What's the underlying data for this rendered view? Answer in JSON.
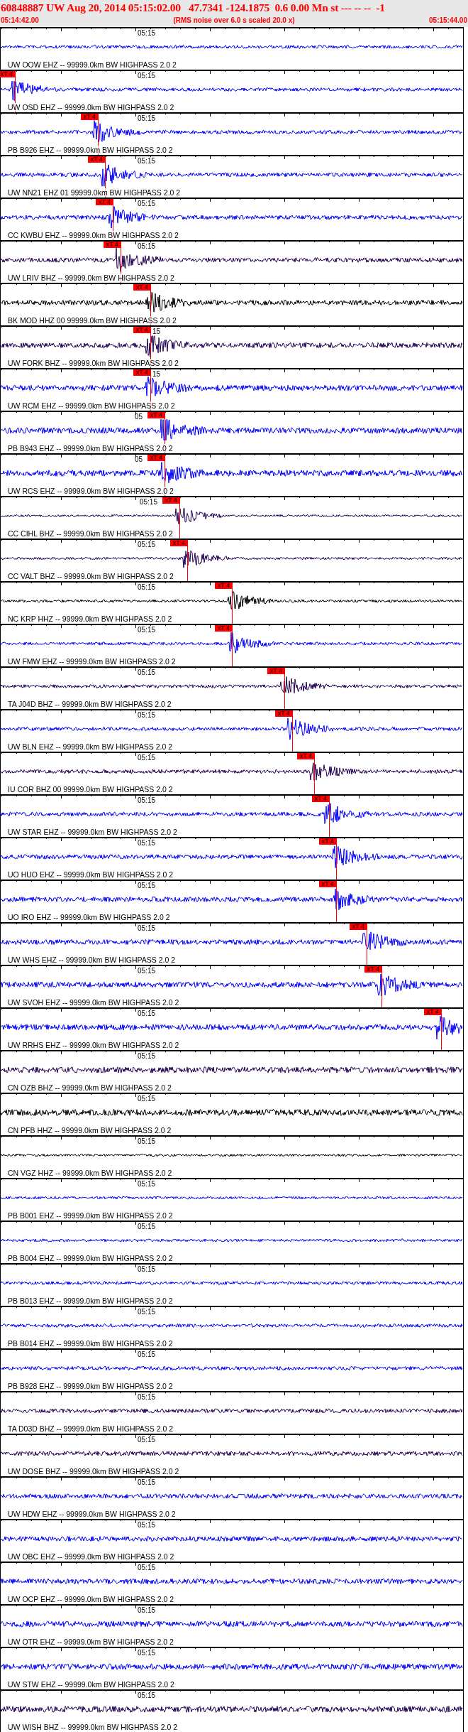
{
  "header": {
    "title": "60848887 UW Aug 20, 2014 05:15:02.00   47.7341 -124.1875  0.6 0.00 Mn st --- -- --  -1",
    "start_time": "05:14:42.00",
    "note": "(RMS noise over 6.0 s scaled 20.0 x)",
    "end_time": "05:15:44.00"
  },
  "traces": [
    {
      "time_mark": "05:15",
      "label": "UW OOW EHZ -- 99999.0km BW HIGHPASS 2.0 2",
      "color": "#0000ff"
    },
    {
      "time_mark": "05:15",
      "label": "UW OSD EHZ -- 99999.0km BW HIGHPASS 2.0 2",
      "color": "#0000ff",
      "pick": {
        "label": "xT 4",
        "level": 0.031
      }
    },
    {
      "time_mark": "05:15",
      "label": "PB B926 EHZ -- 99999.0km BW HIGHPASS 2.0 2",
      "color": "#0000ff",
      "pick": {
        "label": "xT 4",
        "level": 0.21
      }
    },
    {
      "time_mark": "05:15",
      "label": "UW NN21 EHZ 01 99999.0km BW HIGHPASS 2.0 2",
      "color": "#0000ff",
      "pick": {
        "label": "xT 4",
        "level": 0.226
      }
    },
    {
      "time_mark": "05:15",
      "label": "CC KWBU EHZ -- 99999.0km BW HIGHPASS 2.0 2",
      "color": "#0000ff",
      "pick": {
        "label": "xT 4",
        "level": 0.243
      }
    },
    {
      "time_mark": "05:15",
      "label": "UW LRIV BHZ -- 99999.0km BW HIGHPASS 2.0 2",
      "color": "#200050",
      "pick": {
        "label": "xT 4",
        "level": 0.259
      }
    },
    {
      "label": "BK MOD HHZ 00 99999.0km BW HIGHPASS 2.0 2",
      "color": "#000000",
      "pick": {
        "label": "xT 4",
        "level": 0.323
      }
    },
    {
      "time_mark": "15",
      "label": "UW FORK BHZ -- 99999.0km BW HIGHPASS 2.0 2",
      "color": "#200050",
      "pick": {
        "label": "xT 4",
        "level": 0.323
      }
    },
    {
      "time_mark": "15",
      "label": "UW RCM EHZ -- 99999.0km BW HIGHPASS 2.0 2",
      "color": "#0000ff",
      "pick": {
        "label": "xT 4",
        "level": 0.323
      }
    },
    {
      "time_mark": "05",
      "label": "PB B943 EHZ -- 99999.0km BW HIGHPASS 2.0 2",
      "color": "#0000ff",
      "pick": {
        "label": "xT 4",
        "level": 0.355
      }
    },
    {
      "time_mark": "05",
      "label": "UW RCS EHZ -- 99999.0km BW HIGHPASS 2.0 2",
      "color": "#0000ff",
      "pick": {
        "label": "xT 4",
        "level": 0.355
      }
    },
    {
      "time_mark": "05:15",
      "label": "CC CIHL BHZ -- 99999.0km BW HIGHPASS 2.0 2",
      "color": "#200050",
      "pick": {
        "label": "xT 4",
        "level": 0.387
      }
    },
    {
      "time_mark": "05:15",
      "label": "CC VALT BHZ -- 99999.0km BW HIGHPASS 2.0 2",
      "color": "#200050",
      "pick": {
        "label": "xT 4",
        "level": 0.404
      }
    },
    {
      "time_mark": "05:15",
      "label": "NC KRP HHZ -- 99999.0km BW HIGHPASS 2.0 2",
      "color": "#000000",
      "pick": {
        "label": "xT 4",
        "level": 0.5
      }
    },
    {
      "time_mark": "05:15",
      "label": "UW FMW EHZ -- 99999.0km BW HIGHPASS 2.0 2",
      "color": "#0000ff",
      "pick": {
        "label": "xT 4",
        "level": 0.5
      }
    },
    {
      "time_mark": "05:15",
      "label": "TA J04D BHZ -- 99999.0km BW HIGHPASS 2.0 2",
      "color": "#200050",
      "pick": {
        "label": "xT 4",
        "level": 0.614
      }
    },
    {
      "time_mark": "05:15",
      "label": "UW BLN EHZ -- 99999.0km BW HIGHPASS 2.0 2",
      "color": "#0000ff",
      "pick": {
        "label": "xT 4",
        "level": 0.63
      }
    },
    {
      "time_mark": "05:15",
      "label": "IU COR BHZ 00 99999.0km BW HIGHPASS 2.0 2",
      "color": "#200050",
      "pick": {
        "label": "xT 4",
        "level": 0.678
      }
    },
    {
      "time_mark": "05:15",
      "label": "UW STAR EHZ -- 99999.0km BW HIGHPASS 2.0 2",
      "color": "#0000ff",
      "pick": {
        "label": "xT 4",
        "level": 0.71
      }
    },
    {
      "time_mark": "05:15",
      "label": "UO HUO EHZ -- 99999.0km BW HIGHPASS 2.0 2",
      "color": "#0000ff",
      "pick": {
        "label": "xT 4",
        "level": 0.726
      }
    },
    {
      "time_mark": "05:15",
      "label": "UO IRO EHZ -- 99999.0km BW HIGHPASS 2.0 2",
      "color": "#0000ff",
      "pick": {
        "label": "xT 4",
        "level": 0.726
      }
    },
    {
      "time_mark": "05:15",
      "label": "UW WHS EHZ -- 99999.0km BW HIGHPASS 2.0 2",
      "color": "#0000ff",
      "pick": {
        "label": "xT 4",
        "level": 0.792
      }
    },
    {
      "time_mark": "05:15",
      "label": "UW SVOH EHZ -- 99999.0km BW HIGHPASS 2.0 2",
      "color": "#0000ff",
      "pick": {
        "label": "xT 4",
        "level": 0.824
      }
    },
    {
      "time_mark": "05:15",
      "label": "UW RRHS EHZ -- 99999.0km BW HIGHPASS 2.0 2",
      "color": "#0000ff",
      "pick": {
        "label": "xT 4",
        "level": 0.952
      }
    },
    {
      "time_mark": "05:15",
      "label": "CN OZB BHZ -- 99999.0km BW HIGHPASS 2.0 2",
      "color": "#200050"
    },
    {
      "time_mark": "05:15",
      "label": "CN PFB HHZ -- 99999.0km BW HIGHPASS 2.0 2",
      "color": "#000000"
    },
    {
      "time_mark": "05:15",
      "label": "CN VGZ HHZ -- 99999.0km BW HIGHPASS 2.0 2",
      "color": "#000000"
    },
    {
      "time_mark": "05:15",
      "label": "PB B001 EHZ -- 99999.0km BW HIGHPASS 2.0 2",
      "color": "#0000ff"
    },
    {
      "time_mark": "05:15",
      "label": "PB B004 EHZ -- 99999.0km BW HIGHPASS 2.0 2",
      "color": "#0000ff"
    },
    {
      "time_mark": "05:15",
      "label": "PB B013 EHZ -- 99999.0km BW HIGHPASS 2.0 2",
      "color": "#0000ff"
    },
    {
      "time_mark": "05:15",
      "label": "PB B014 EHZ -- 99999.0km BW HIGHPASS 2.0 2",
      "color": "#0000ff"
    },
    {
      "time_mark": "05:15",
      "label": "PB B928 EHZ -- 99999.0km BW HIGHPASS 2.0 2",
      "color": "#0000ff"
    },
    {
      "time_mark": "05:15",
      "label": "TA D03D BHZ -- 99999.0km BW HIGHPASS 2.0 2",
      "color": "#200050"
    },
    {
      "time_mark": "05:15",
      "label": "UW DOSE BHZ -- 99999.0km BW HIGHPASS 2.0 2",
      "color": "#200050"
    },
    {
      "time_mark": "05:15",
      "label": "UW HDW EHZ -- 99999.0km BW HIGHPASS 2.0 2",
      "color": "#0000ff"
    },
    {
      "time_mark": "05:15",
      "label": "UW OBC EHZ -- 99999.0km BW HIGHPASS 2.0 2",
      "color": "#0000ff"
    },
    {
      "time_mark": "05:15",
      "label": "UW OCP EHZ -- 99999.0km BW HIGHPASS 2.0 2",
      "color": "#0000ff"
    },
    {
      "time_mark": "05:15",
      "label": "UW OTR EHZ -- 99999.0km BW HIGHPASS 2.0 2",
      "color": "#0000ff"
    },
    {
      "time_mark": "05:15",
      "label": "UW STW EHZ -- 99999.0km BW HIGHPASS 2.0 2",
      "color": "#0000ff"
    },
    {
      "time_mark": "05:15",
      "label": "UW WISH BHZ -- 99999.0km BW HIGHPASS 2.0 2",
      "color": "#200050"
    }
  ]
}
